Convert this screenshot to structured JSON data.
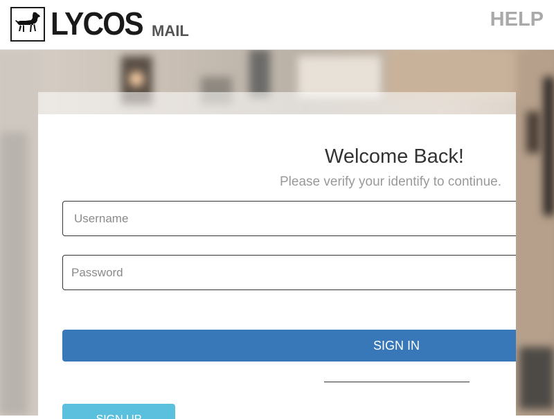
{
  "brand": {
    "name": "LYCOS",
    "product": "MAIL",
    "logo_icon": "dog-icon"
  },
  "header": {
    "help_label": "HELP"
  },
  "login": {
    "title": "Welcome Back!",
    "subtitle": "Please verify your identify to continue.",
    "username_placeholder": "Username",
    "password_placeholder": "Password",
    "signin_label": "SIGN IN",
    "signup_label": "SIGN UP"
  },
  "colors": {
    "primary": "#3878b8",
    "info": "#5bc0de",
    "muted_text": "#999999",
    "help_text": "#a9a9a9"
  }
}
